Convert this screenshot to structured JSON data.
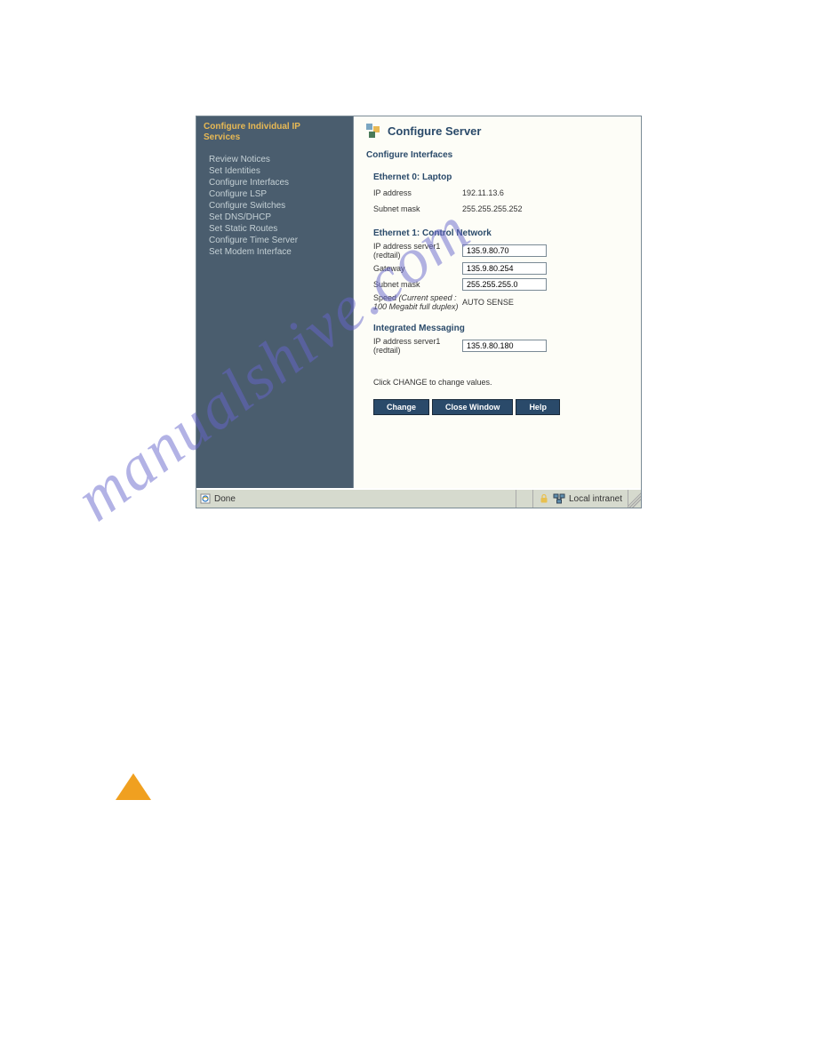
{
  "sidebar": {
    "title_line1": "Configure Individual IP",
    "title_line2": "Services",
    "links": [
      "Review Notices",
      "Set Identities",
      "Configure Interfaces",
      "Configure LSP",
      "Configure Switches",
      "Set DNS/DHCP",
      "Set Static Routes",
      "Configure Time Server",
      "Set Modem Interface"
    ]
  },
  "content": {
    "title": "Configure Server",
    "section": "Configure Interfaces",
    "eth0": {
      "heading": "Ethernet 0: Laptop",
      "ip_label": "IP address",
      "ip_value": "192.11.13.6",
      "mask_label": "Subnet mask",
      "mask_value": "255.255.255.252"
    },
    "eth1": {
      "heading": "Ethernet 1: Control Network",
      "ip_label": "IP address server1 (redtail)",
      "ip_value": "135.9.80.70",
      "gateway_label": "Gateway",
      "gateway_value": "135.9.80.254",
      "mask_label": "Subnet mask",
      "mask_value": "255.255.255.0",
      "speed_label": "Speed",
      "speed_note": "(Current speed : 100 Megabit full duplex)",
      "speed_value": "AUTO SENSE"
    },
    "im": {
      "heading": "Integrated Messaging",
      "ip_label": "IP address server1 (redtail)",
      "ip_value": "135.9.80.180"
    },
    "instruction": "Click CHANGE to change values.",
    "buttons": {
      "change": "Change",
      "close": "Close Window",
      "help": "Help"
    }
  },
  "status": {
    "done": "Done",
    "zone": "Local intranet"
  },
  "watermark": "manualshive.com"
}
